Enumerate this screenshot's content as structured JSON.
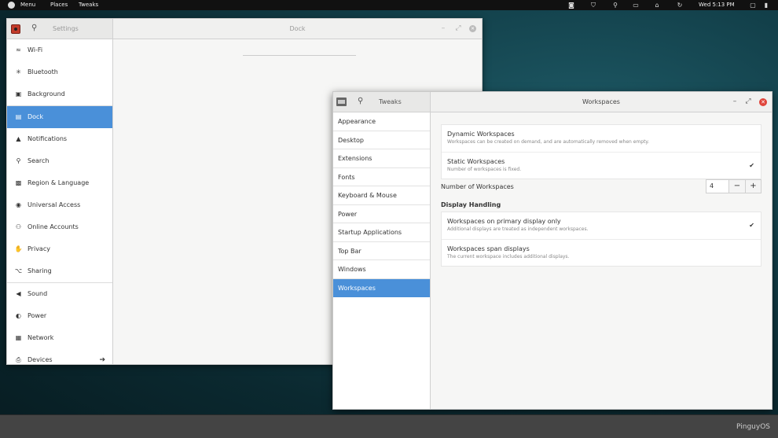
{
  "topbar": {
    "menu": "Menu",
    "places": "Places",
    "tweaks": "Tweaks",
    "clock": "Wed  5:13 PM"
  },
  "settings": {
    "header_title": "Settings",
    "panel_title": "Dock",
    "sidebar": [
      {
        "label": "Wi-Fi",
        "icon": "wifi-icon",
        "glyph": "≈"
      },
      {
        "label": "Bluetooth",
        "icon": "bluetooth-icon",
        "glyph": "✳"
      },
      {
        "label": "Background",
        "icon": "background-icon",
        "glyph": "▣"
      },
      {
        "label": "Dock",
        "icon": "dock-icon",
        "glyph": "▤"
      },
      {
        "label": "Notifications",
        "icon": "bell-icon",
        "glyph": "▲"
      },
      {
        "label": "Search",
        "icon": "search-icon",
        "glyph": "⚲"
      },
      {
        "label": "Region & Language",
        "icon": "camera-icon",
        "glyph": "▩"
      },
      {
        "label": "Universal Access",
        "icon": "accessibility-icon",
        "glyph": "◉"
      },
      {
        "label": "Online Accounts",
        "icon": "online-accounts-icon",
        "glyph": "⚇"
      },
      {
        "label": "Privacy",
        "icon": "hand-icon",
        "glyph": "✋"
      },
      {
        "label": "Sharing",
        "icon": "share-icon",
        "glyph": "⌥"
      },
      {
        "label": "Sound",
        "icon": "speaker-icon",
        "glyph": "◀"
      },
      {
        "label": "Power",
        "icon": "power-icon",
        "glyph": "◐"
      },
      {
        "label": "Network",
        "icon": "network-icon",
        "glyph": "▦"
      },
      {
        "label": "Devices",
        "icon": "devices-icon",
        "glyph": "⎙"
      }
    ],
    "devices_arrow": "➔"
  },
  "tweaks": {
    "header_title": "Tweaks",
    "panel_title": "Workspaces",
    "sidebar": [
      "Appearance",
      "Desktop",
      "Extensions",
      "Fonts",
      "Keyboard & Mouse",
      "Power",
      "Startup Applications",
      "Top Bar",
      "Windows",
      "Workspaces"
    ],
    "selected": "Workspaces",
    "dynamic": {
      "title": "Dynamic Workspaces",
      "desc": "Workspaces can be created on demand, and are automatically removed when empty."
    },
    "static": {
      "title": "Static Workspaces",
      "desc": "Number of workspaces is fixed."
    },
    "number_label": "Number of Workspaces",
    "number_value": "4",
    "display_heading": "Display Handling",
    "primary": {
      "title": "Workspaces on primary display only",
      "desc": "Additional displays are treated as independent workspaces."
    },
    "span": {
      "title": "Workspaces span displays",
      "desc": "The current workspace includes additional displays."
    }
  },
  "brand": "PinguyOS",
  "colors": {
    "accent": "#4a90d9",
    "close": "#e0453b"
  }
}
